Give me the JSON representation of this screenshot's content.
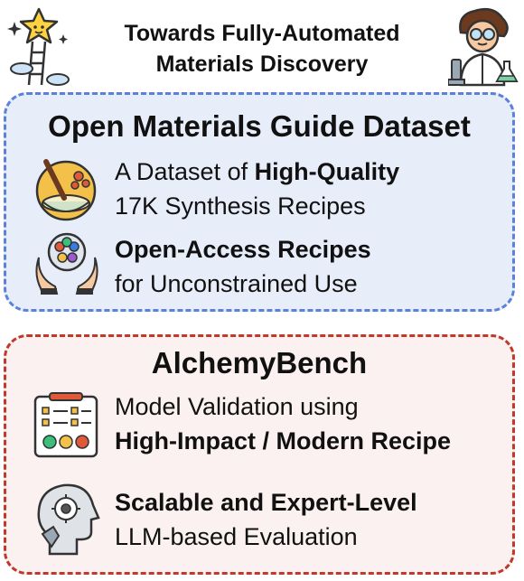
{
  "header": {
    "title_line1": "Towards Fully-Automated",
    "title_line2": "Materials Discovery"
  },
  "dataset_panel": {
    "title": "Open Materials Guide Dataset",
    "features": [
      {
        "icon": "mixing-bowl-icon",
        "line1_prefix": "A Dataset of ",
        "line1_bold": "High-Quality",
        "line2": "17K Synthesis Recipes"
      },
      {
        "icon": "hands-community-icon",
        "line1_bold": "Open-Access Recipes",
        "line2": "for Unconstrained Use"
      }
    ],
    "border_color": "#5b82d8",
    "background": "#e8eef9"
  },
  "bench_panel": {
    "title": "AlchemyBench",
    "features": [
      {
        "icon": "checklist-feedback-icon",
        "line1": "Model Validation using",
        "line2_bold": "High-Impact / Modern Recipe"
      },
      {
        "icon": "ai-head-icon",
        "line1_bold": "Scalable and Expert-Level",
        "line2": "LLM-based Evaluation"
      }
    ],
    "border_color": "#c0392b",
    "background": "#fbf1f1"
  },
  "decor_icons": [
    "star-ladder-icon",
    "scientist-icon"
  ]
}
